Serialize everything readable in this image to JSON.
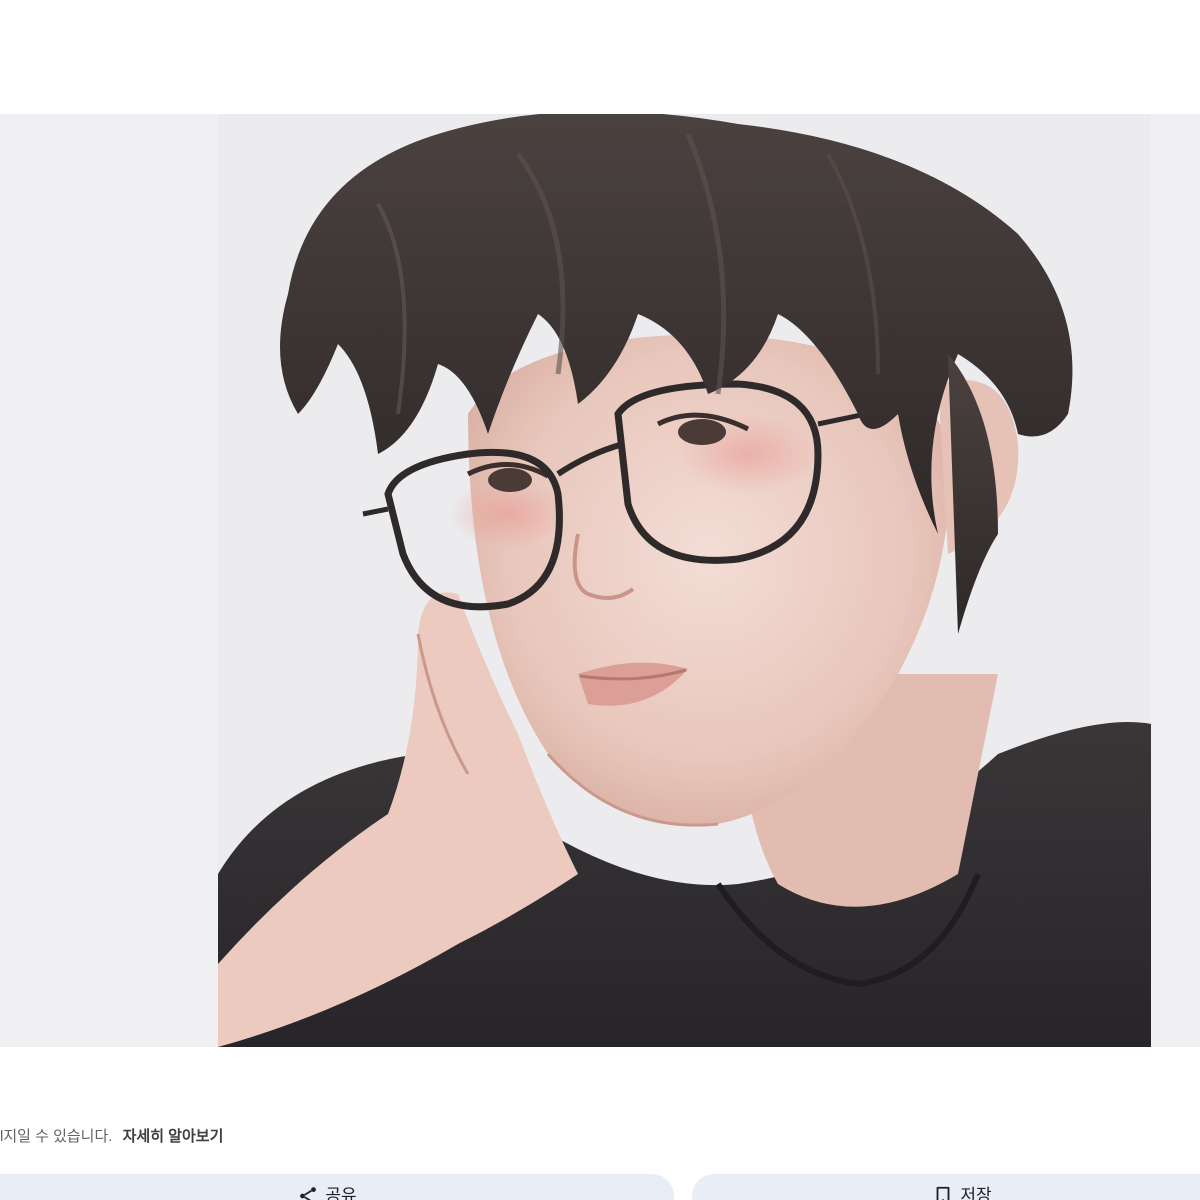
{
  "image_viewer": {
    "artwork_icon": "illustrated-portrait"
  },
  "notice": {
    "text": "l지일 수 있습니다.",
    "learn_more": "자세히 알아보기"
  },
  "actions": {
    "share": {
      "label": "공유",
      "icon": "share-icon"
    },
    "save": {
      "label": "저장",
      "icon": "bookmark-icon"
    }
  },
  "colors": {
    "button_bg": "#e8edf8",
    "panel_bg": "#f0f0f2",
    "notice_text": "#5f6368"
  }
}
